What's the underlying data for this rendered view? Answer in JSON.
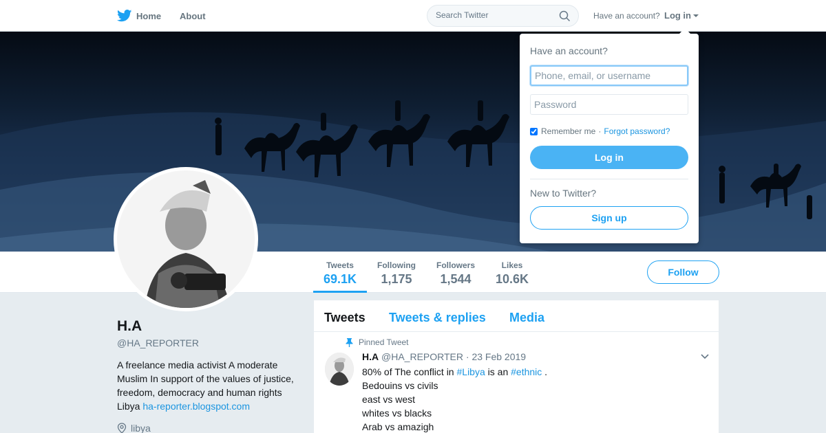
{
  "nav": {
    "home_label": "Home",
    "about_label": "About",
    "search_placeholder": "Search Twitter",
    "have_account": "Have an account?",
    "login_label": "Log in"
  },
  "profile": {
    "name": "H.A",
    "handle": "@HA_REPORTER",
    "bio": "A freelance media activist A moderate Muslim In support of the values of justice, freedom, democracy and human rights Libya",
    "bio_link": "ha-reporter.blogspot.com",
    "location": "libya"
  },
  "stats": [
    {
      "label": "Tweets",
      "value": "69.1K"
    },
    {
      "label": "Following",
      "value": "1,175"
    },
    {
      "label": "Followers",
      "value": "1,544"
    },
    {
      "label": "Likes",
      "value": "10.6K"
    }
  ],
  "follow_label": "Follow",
  "timeline": {
    "tabs": [
      "Tweets",
      "Tweets & replies",
      "Media"
    ],
    "pinned_label": "Pinned Tweet",
    "tweet": {
      "name": "H.A",
      "handle": "@HA_REPORTER",
      "date": "23 Feb 2019",
      "line1_pre": "80% of The conflict in",
      "hashtag1": "#Libya",
      "line1_mid": "is an",
      "hashtag2": "#ethnic",
      "line1_end": ".",
      "lines": [
        "Bedouins vs civils",
        "east vs west",
        "whites vs blacks",
        "Arab vs amazigh"
      ]
    }
  },
  "login_dropdown": {
    "title": "Have an account?",
    "username_placeholder": "Phone, email, or username",
    "password_placeholder": "Password",
    "remember_label": "Remember me",
    "separator": "·",
    "forgot_label": "Forgot password?",
    "login_button": "Log in",
    "new_label": "New to Twitter?",
    "signup_button": "Sign up"
  },
  "colors": {
    "accent": "#1da1f2",
    "login_button": "#4ab3f4",
    "link": "#1b95e0",
    "page_bg": "#e6ecf0"
  }
}
